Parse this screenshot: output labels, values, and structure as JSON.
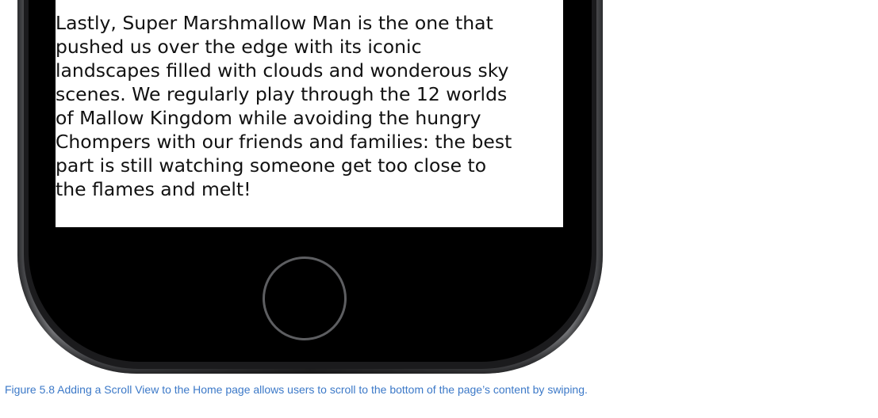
{
  "screen": {
    "lines": [
      "Lastly, Super Marshmallow Man is the one that",
      "pushed us over the edge with its iconic",
      "landscapes filled with clouds and wonderous sky",
      "scenes. We regularly play through the 12 worlds",
      "of Mallow Kingdom while avoiding the hungry",
      "Chompers with our friends and families: the best",
      "part is still watching someone get too close to",
      "the flames and melt!"
    ]
  },
  "caption": {
    "text": "Figure 5.8 Adding a Scroll View to the Home page allows users to scroll to the bottom of the page’s content by swiping."
  },
  "colors": {
    "caption": "#3c79c8",
    "phone_body": "#2c2c2e",
    "screen_bg": "#ffffff",
    "home_ring": "#5d5e61"
  },
  "icons": {
    "home_button": "home-button-icon"
  }
}
